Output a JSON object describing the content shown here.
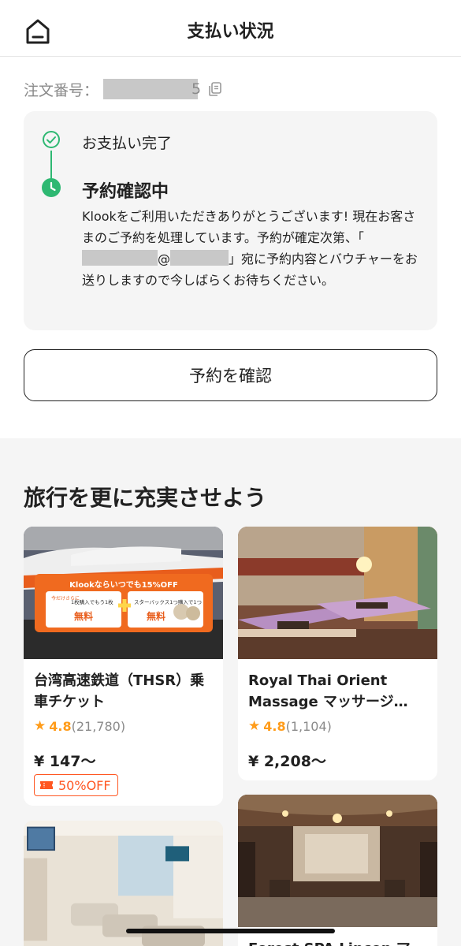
{
  "header": {
    "title": "支払い状況",
    "home_icon": "home-icon"
  },
  "order": {
    "label": "注文番号：",
    "visible_tail": "5"
  },
  "status": {
    "step1_label": "お支払い完了",
    "step2_label": "予約確認中",
    "desc_part1": "Klookをご利用いただきありがとうございます! 現在お客さまのご予約を処理しています。予約が確定次第、「",
    "desc_at": "@",
    "desc_part2": "」宛に予約内容とバウチャーをお送りしますので今しばらくお待ちください。",
    "colors": {
      "accent": "#2eb872"
    }
  },
  "confirm_button": "予約を確認",
  "recommend": {
    "title": "旅行を更に充実させよう",
    "cards": [
      {
        "name": "台湾高速鉄道（THSR）乗車チケット",
        "rating": "4.8",
        "reviews": "(21,780)",
        "price": "¥ 147〜",
        "badge": "50%OFF",
        "banner_text_1": "Klookならいつでも15%OFF",
        "banner_text_2": "今だけさらに",
        "banner_text_3": "1枚購入でもう1枚",
        "banner_text_4": "無料",
        "banner_text_5": "スターバックス1つ購入で1つ",
        "banner_text_6": "無料"
      },
      {
        "name": "Royal Thai Orient Massage マッサージ…",
        "rating": "4.8",
        "reviews": "(1,104)",
        "price": "¥ 2,208〜"
      },
      {
        "name": ""
      },
      {
        "name": "Forest SPA Lincon マ"
      }
    ]
  }
}
